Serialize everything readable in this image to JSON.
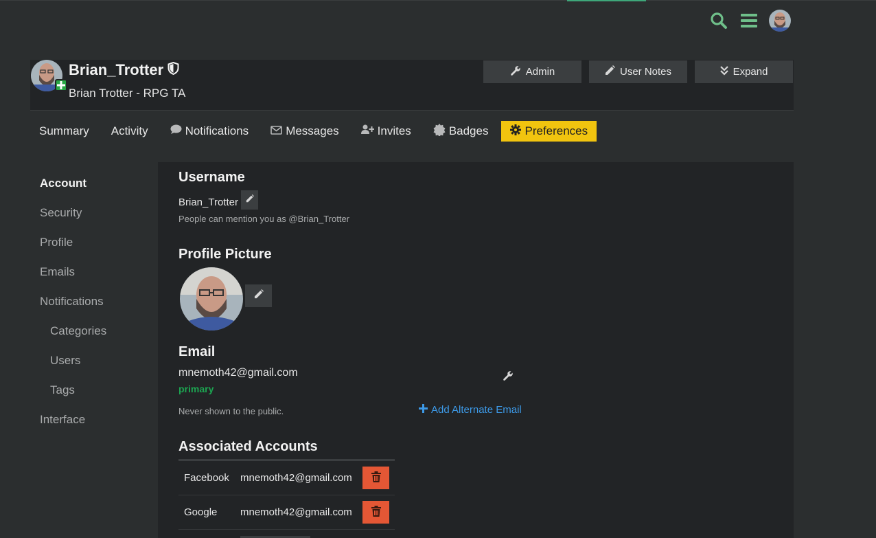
{
  "header": {
    "icons": [
      "search-icon",
      "hamburger-menu-icon",
      "current-user-avatar"
    ],
    "accent_color": "#3ea77a"
  },
  "user": {
    "name": "Brian_Trotter",
    "title": "Brian Trotter - RPG TA",
    "buttons": {
      "admin": "Admin",
      "user_notes": "User Notes",
      "expand": "Expand"
    }
  },
  "nav": {
    "summary": "Summary",
    "activity": "Activity",
    "notifications": "Notifications",
    "messages": "Messages",
    "invites": "Invites",
    "badges": "Badges",
    "preferences": "Preferences",
    "active_color": "#f1c40f"
  },
  "sidebar": {
    "items": [
      {
        "label": "Account",
        "active": true
      },
      {
        "label": "Security"
      },
      {
        "label": "Profile"
      },
      {
        "label": "Emails"
      },
      {
        "label": "Notifications"
      },
      {
        "label": "Categories",
        "sub": true
      },
      {
        "label": "Users",
        "sub": true
      },
      {
        "label": "Tags",
        "sub": true
      },
      {
        "label": "Interface"
      }
    ]
  },
  "account": {
    "username_heading": "Username",
    "username_value": "Brian_Trotter",
    "username_hint": "People can mention you as @Brian_Trotter",
    "picture_heading": "Profile Picture",
    "email_heading": "Email",
    "email_value": "mnemoth42@gmail.com",
    "email_badge": "primary",
    "email_hint": "Never shown to the public.",
    "add_email": "Add Alternate Email",
    "associated_heading": "Associated Accounts",
    "associated": [
      {
        "provider": "Facebook",
        "email": "mnemoth42@gmail.com"
      },
      {
        "provider": "Google",
        "email": "mnemoth42@gmail.com"
      }
    ],
    "danger_color": "#e45735"
  }
}
